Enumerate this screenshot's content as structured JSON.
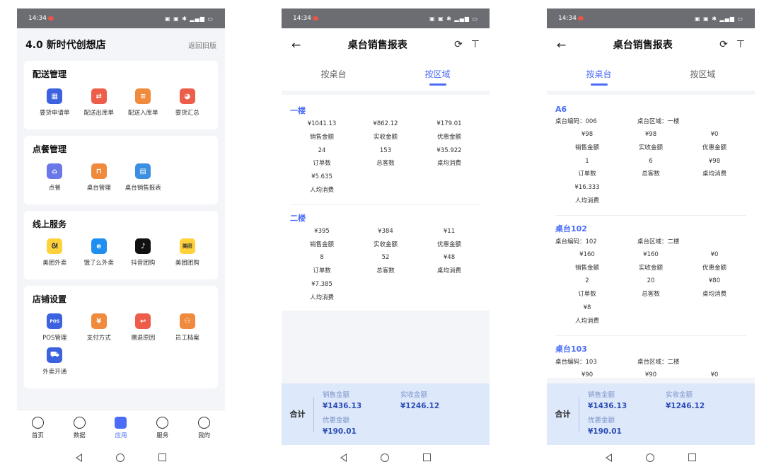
{
  "status": {
    "time": "14:34"
  },
  "home": {
    "title": "4.0 新时代创想店",
    "back_link": "返回旧版",
    "sections": [
      {
        "title": "配送管理",
        "items": [
          "要货申请单",
          "配送出库单",
          "配送入库单",
          "要货汇总"
        ]
      },
      {
        "title": "点餐管理",
        "items": [
          "点餐",
          "桌台管理",
          "桌台销售报表"
        ]
      },
      {
        "title": "线上服务",
        "items": [
          "美团外卖",
          "饿了么外卖",
          "抖音团购",
          "美团团购"
        ]
      },
      {
        "title": "店铺设置",
        "items": [
          "POS管理",
          "支付方式",
          "赠退原因",
          "员工档案",
          "外卖开通"
        ]
      }
    ],
    "icon_glyphs": {
      "pos": "POS",
      "meituan": "美团",
      "douyin": "♪",
      "eleme": "e"
    },
    "tabbar": [
      "首页",
      "数据",
      "应用",
      "服务",
      "我的"
    ]
  },
  "report": {
    "title": "桌台销售报表",
    "tab_table": "按桌台",
    "tab_area": "按区域",
    "footer": {
      "label": "合计",
      "sales_label": "销售金额",
      "sales_value": "¥1436.13",
      "received_label": "实收金额",
      "received_value": "¥1246.12",
      "discount_label": "优惠金额",
      "discount_value": "¥190.01"
    }
  },
  "area_report": [
    {
      "name": "一楼",
      "sales": "¥1041.13",
      "received": "¥862.12",
      "discount": "¥179.01",
      "orders": "24",
      "guests": "153",
      "per_table": "¥35.922",
      "per_person": "¥5.635"
    },
    {
      "name": "二楼",
      "sales": "¥395",
      "received": "¥384",
      "discount": "¥11",
      "orders": "8",
      "guests": "52",
      "per_table": "¥48",
      "per_person": "¥7.385"
    }
  ],
  "table_report": [
    {
      "name": "A6",
      "code_line": "桌台编码：006",
      "area_line": "桌台区域：一楼",
      "sales": "¥98",
      "received": "¥98",
      "discount": "¥0",
      "orders": "1",
      "guests": "6",
      "per_table": "¥98",
      "per_person": "¥16.333"
    },
    {
      "name": "桌台102",
      "code_line": "桌台编码：102",
      "area_line": "桌台区域：二楼",
      "sales": "¥160",
      "received": "¥160",
      "discount": "¥0",
      "orders": "2",
      "guests": "20",
      "per_table": "¥80",
      "per_person": "¥8"
    },
    {
      "name": "桌台103",
      "code_line": "桌台编码：103",
      "area_line": "桌台区域：二楼",
      "sales": "¥90",
      "received": "¥90",
      "discount": "¥0"
    }
  ],
  "labels": {
    "sales": "销售金额",
    "received": "实收金额",
    "discount": "优惠金额",
    "orders": "订单数",
    "guests": "总客数",
    "per_table": "桌均消费",
    "per_person": "人均消费"
  },
  "colors": {
    "accent": "#4a6cf7",
    "footer_bg": "#dde8fb"
  }
}
